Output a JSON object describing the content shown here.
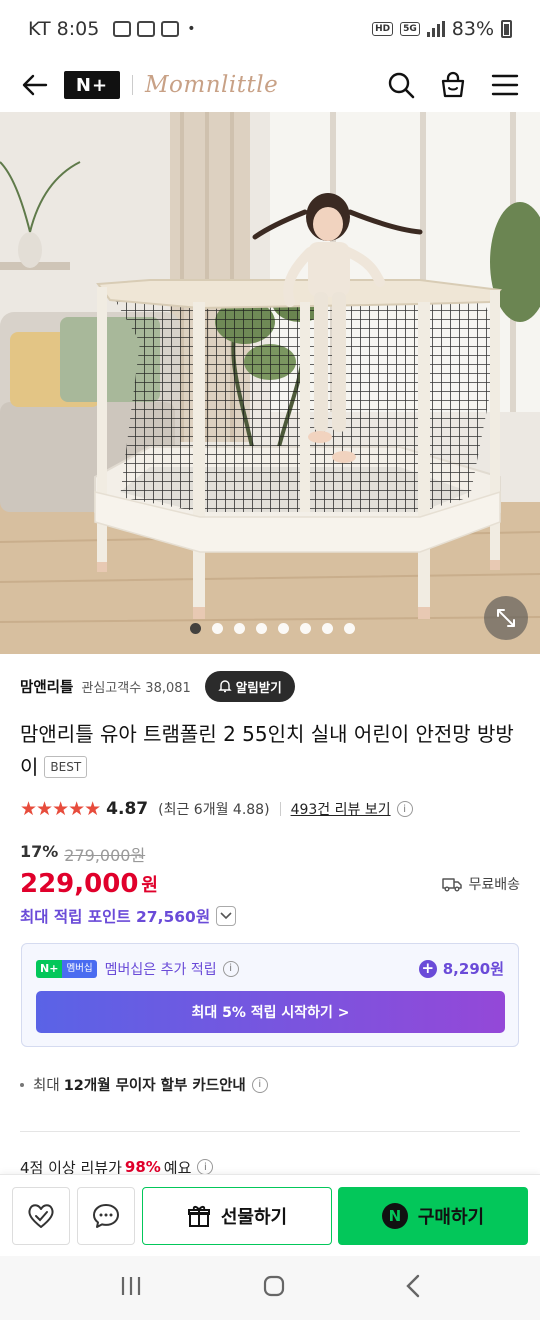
{
  "status": {
    "carrier_time": "KT 8:05",
    "dot": "•",
    "battery": "83%",
    "badges": [
      "HD",
      "5G"
    ]
  },
  "nav": {
    "nplus_label": "N+",
    "brand": "Momnlittle"
  },
  "gallery": {
    "slide_count": 8,
    "active_index": 0
  },
  "shop": {
    "name": "맘앤리틀",
    "interest": "관심고객수 38,081",
    "alarm_button": "알림받기"
  },
  "product": {
    "title": "맘앤리틀 유아 트램폴린 2 55인치 실내 어린이 안전망 방방이",
    "badge": "BEST",
    "stars": "★★★★★",
    "rating": "4.87",
    "recent_rating": "(최근 6개월 4.88)",
    "review_link": "493건 리뷰 보기",
    "discount_rate": "17%",
    "original_price": "279,000원",
    "price": "229,000",
    "currency": "원",
    "shipping": "무료배송",
    "max_points": "최대 적립 포인트 27,560원"
  },
  "membership": {
    "badge_n": "N+",
    "badge_text": "멤버십",
    "text": "멤버십은 추가 적립",
    "points": "8,290원",
    "start_button": "최대 5% 적립 시작하기 >"
  },
  "card": {
    "prefix": "최대",
    "bold": "12개월 무이자 할부 카드안내"
  },
  "review_summary": {
    "prefix": "4점 이상 리뷰가",
    "percent": "98%",
    "suffix": "예요"
  },
  "bottom_bar": {
    "gift_button": "선물하기",
    "buy_n": "N",
    "buy_button": "구매하기"
  },
  "colors": {
    "accent_red": "#e0002b",
    "naver_green": "#03c75a",
    "purple": "#6a4bd8"
  }
}
